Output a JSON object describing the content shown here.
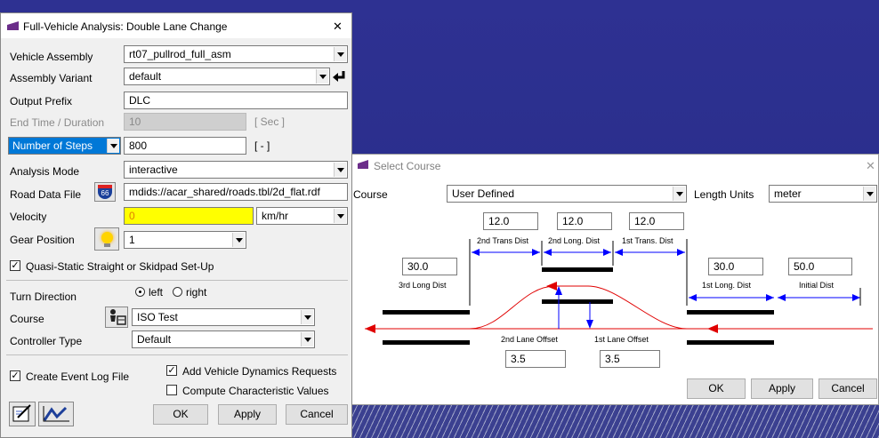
{
  "main_dialog": {
    "title": "Full-Vehicle Analysis: Double Lane Change",
    "close_glyph": "✕",
    "vehicle_assembly_label": "Vehicle Assembly",
    "vehicle_assembly_value": "rt07_pullrod_full_asm",
    "assembly_variant_label": "Assembly Variant",
    "assembly_variant_value": "default",
    "output_prefix_label": "Output Prefix",
    "output_prefix_value": "DLC",
    "end_time_label": "End Time / Duration",
    "end_time_value": "10",
    "end_time_unit": "[ Sec ]",
    "steps_selector": "Number of Steps",
    "steps_value": "800",
    "steps_unit": "[ - ]",
    "analysis_mode_label": "Analysis Mode",
    "analysis_mode_value": "interactive",
    "road_data_label": "Road Data File",
    "road_data_value": "mdids://acar_shared/roads.tbl/2d_flat.rdf",
    "velocity_label": "Velocity",
    "velocity_value": "0",
    "velocity_unit": "km/hr",
    "gear_label": "Gear Position",
    "gear_value": "1",
    "quasi_static_label": "Quasi-Static Straight or Skidpad Set-Up",
    "turn_direction_label": "Turn Direction",
    "turn_left": "left",
    "turn_right": "right",
    "course_label": "Course",
    "course_value": "ISO Test",
    "controller_label": "Controller Type",
    "controller_value": "Default",
    "event_log_label": "Create Event Log File",
    "add_vdr_label": "Add Vehicle Dynamics Requests",
    "compute_char_label": "Compute Characteristic Values",
    "ok": "OK",
    "apply": "Apply",
    "cancel": "Cancel",
    "road_icon_text": "66"
  },
  "course_dialog": {
    "title": "Select Course",
    "close_glyph": "✕",
    "course_label": "Course",
    "course_value": "User Defined",
    "length_units_label": "Length Units",
    "length_units_value": "meter",
    "trans_dist_2_value": "12.0",
    "trans_dist_2_label": "2nd Trans Dist",
    "long_dist_2_value": "12.0",
    "long_dist_2_label": "2nd Long. Dist",
    "trans_dist_1_value": "12.0",
    "trans_dist_1_label": "1st Trans. Dist",
    "long_dist_3_value": "30.0",
    "long_dist_3_label": "3rd Long Dist",
    "long_dist_1_value": "30.0",
    "long_dist_1_label": "1st Long. Dist",
    "initial_dist_value": "50.0",
    "initial_dist_label": "Initial Dist",
    "lane_offset_2_label": "2nd Lane Offset",
    "lane_offset_2_value": "3.5",
    "lane_offset_1_label": "1st Lane Offset",
    "lane_offset_1_value": "3.5",
    "ok": "OK",
    "apply": "Apply",
    "cancel": "Cancel"
  },
  "colors": {
    "accent": "#0078d7",
    "path": "#e00000",
    "arrow": "#0000ff",
    "velocity_bg": "#ffff00",
    "background": "#2a2f8a"
  }
}
